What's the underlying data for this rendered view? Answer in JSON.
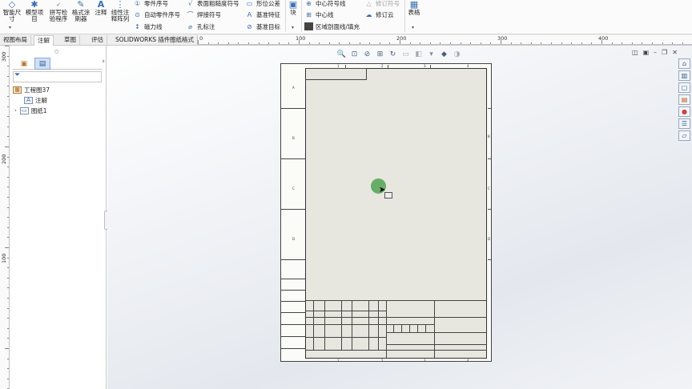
{
  "ribbon": {
    "groups": [
      {
        "label": "智能尺\n寸",
        "icon": "smart-dimension-icon"
      },
      {
        "label": "模型项\n目",
        "icon": "model-items-icon"
      },
      {
        "label": "拼写检\n验程序",
        "icon": "spell-check-icon"
      },
      {
        "label": "格式涂\n刷器",
        "icon": "format-painter-icon"
      },
      {
        "label": "注释",
        "icon": "note-icon"
      },
      {
        "label": "线性注\n释阵列",
        "icon": "linear-note-pattern-icon"
      }
    ],
    "col1": [
      "零件序号",
      "自动零件序号",
      "磁力线"
    ],
    "col2": [
      "表面粗糙度符号",
      "焊接符号",
      "孔标注"
    ],
    "col3": [
      "形位公差",
      "基准特征",
      "基准目标"
    ],
    "block": "块",
    "col4": [
      "中心符号线",
      "中心线",
      "区域剖面线/填充"
    ],
    "col5": [
      "修订符号",
      "修订云"
    ],
    "table": "表格"
  },
  "tabs": [
    "视图布局",
    "注解",
    "草图",
    "评估",
    "SOLIDWORKS 插件",
    "图纸格式"
  ],
  "active_tab": "注解",
  "hruler": [
    "0",
    "100",
    "200",
    "300",
    "400"
  ],
  "vruler": [
    "300",
    "200",
    "100"
  ],
  "tree": {
    "root": "工程图37",
    "annotations": "注解",
    "sheet": "图纸1"
  },
  "sheet_zones": {
    "rows": [
      "A",
      "B",
      "C",
      "D"
    ],
    "cols": [
      "1",
      "2",
      "3",
      "4"
    ]
  }
}
